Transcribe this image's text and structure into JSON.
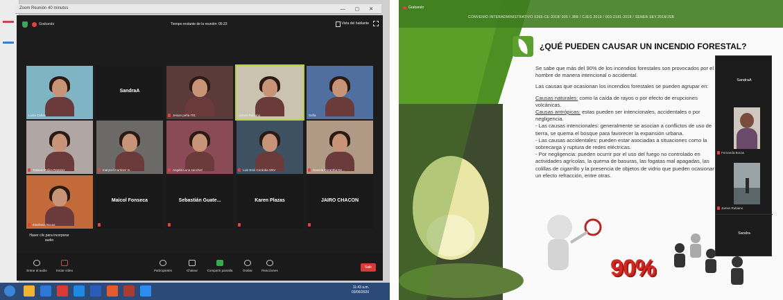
{
  "left_window": {
    "title": "Zoom Reunión 40 minutos",
    "recording_label": "Grabando",
    "timer": "Tiempo restante de la reunión: 05:23",
    "speaker_view": "Vista del hablante",
    "join_audio_hint": "Haser clic para incorporar audio",
    "participants": [
      {
        "name": "Luisa Cañas",
        "kind": "photo",
        "tone": "#7fb4c4",
        "muted": false
      },
      {
        "name": "SandraA",
        "kind": "name",
        "muted": false
      },
      {
        "name": "Jeison peña 701",
        "kind": "photo",
        "tone": "#5c3a3a",
        "muted": true
      },
      {
        "name": "James Rubiano",
        "kind": "photo",
        "tone": "#c9c3b0",
        "muted": false,
        "highlight": true
      },
      {
        "name": "Sofía",
        "kind": "photo",
        "tone": "#4e6fa0",
        "muted": false
      },
      {
        "name": "Tatiana Mojica Ramirez",
        "kind": "photo",
        "tone": "#b0a6a4",
        "muted": true
      },
      {
        "name": "marycel martinez m.",
        "kind": "photo",
        "tone": "#6c6a68",
        "muted": true
      },
      {
        "name": "Angela Luna sanchez",
        "kind": "photo",
        "tone": "#8a4b57",
        "muted": true
      },
      {
        "name": "Luis Emil Cordoba SNV",
        "kind": "photo",
        "tone": "#3e5163",
        "muted": true
      },
      {
        "name": "Daniela Dorantha De...",
        "kind": "photo",
        "tone": "#b09a86",
        "muted": true
      },
      {
        "name": "Estefania Bocas",
        "kind": "photo",
        "tone": "#c36a3a",
        "muted": true
      },
      {
        "name": "Maicol Fonseca",
        "kind": "name",
        "muted": true
      },
      {
        "name": "Sebastián Guate...",
        "kind": "name",
        "muted": true
      },
      {
        "name": "Karen Plazas",
        "kind": "name",
        "muted": true
      },
      {
        "name": "JAIRO CHACON",
        "kind": "name",
        "muted": true
      }
    ],
    "toolbar": {
      "join_audio": "Entrar al audio",
      "start_video": "Iniciar vídeo",
      "participants": "Participantes",
      "participants_count": "15",
      "chat": "Chatear",
      "share": "Compartir pantalla",
      "record": "Grabar",
      "reactions": "Reacciones",
      "end": "Salir"
    },
    "taskbar": {
      "time": "11:43 a.m.",
      "date": "03/06/2020",
      "apps": [
        "#f2b233",
        "#2d78d6",
        "#d93a33",
        "#1e88e5",
        "#2b5cb8",
        "#e35a2b",
        "#ad3a2e",
        "#2d8cf0"
      ]
    }
  },
  "right_window": {
    "recording_label": "Grabando",
    "header": "CONVENIO INTERADMINISTRATIVO 0265-CE-2018/ 005 / JBB / CJEG 2019 / 003-2181-2018 / SENER SEY.2018/JSB",
    "slide_title": "¿QUÉ PUEDEN CAUSAR UN INCENDIO FORESTAL?",
    "paragraphs": [
      "Se sabe que más del 90% de los incendios forestales son provocados por el hombre de manera intencional o accidental.",
      "Las causas que ocasionan los incendios forestales se pueden agrupar en:"
    ],
    "natural_label": "Causas naturales:",
    "natural_text": " como la caída de rayos o por efecto de erupciones volcánicas.",
    "anthropic_label": "Causas antrópicas:",
    "anthropic_text": " estas pueden ser intencionales, accidentales o por negligencia.",
    "bullets": [
      "- Las causas intencionales: generalmente se asocian a conflictos de uso de tierra, se quema el bosque para favorecer la expansión urbana.",
      "- Las causas accidentales: pueden estar asociadas a situaciones como la sobrecarga y ruptura de redes eléctricas.",
      "- Por negligencia: pueden ocurrir por el uso del fuego no controlado en actividades agrícolas, la quema de basuras, las fogatas mal apagadas, las colillas de cigarrillo y la presencia de objetos de vidrio que pueden ocasionar un efecto refracción, entre otras."
    ],
    "big_figure": "90%",
    "gallery": {
      "top_name": "SandraA",
      "tile1_name": "Fernanda Bocas",
      "tile2_name": "James Rubiano",
      "bottom_name": "Sandra"
    }
  },
  "colors": {
    "zoom_bg": "#1c1c1c",
    "accent_green": "#5aa02c",
    "red_end": "#d93a33",
    "highlight": "#b6d33a"
  }
}
